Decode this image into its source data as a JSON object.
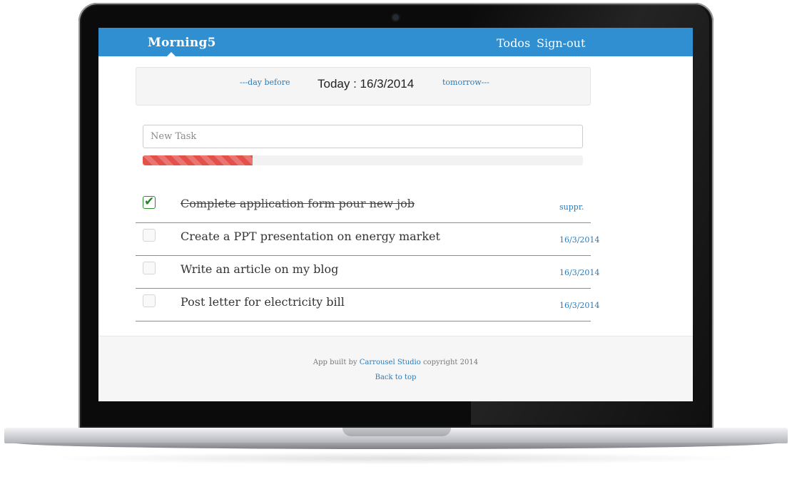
{
  "navbar": {
    "brand": "Morning5",
    "links": {
      "todos": "Todos",
      "signout": "Sign-out"
    },
    "color": "#2f8fd0"
  },
  "date_nav": {
    "prev_label": "---day before",
    "today_label": "Today : 16/3/2014",
    "next_label": "tomorrow---"
  },
  "new_task": {
    "placeholder": "New Task",
    "value": ""
  },
  "progress": {
    "percent": 25,
    "color": "#e4504a"
  },
  "tasks": [
    {
      "text": "Complete application form pour new job",
      "done": true,
      "meta": "suppr."
    },
    {
      "text": "Create a PPT presentation on energy market",
      "done": false,
      "meta": "16/3/2014"
    },
    {
      "text": "Write an article on my blog",
      "done": false,
      "meta": "16/3/2014"
    },
    {
      "text": "Post letter for electricity bill",
      "done": false,
      "meta": "16/3/2014"
    }
  ],
  "footer": {
    "prefix": "App built by ",
    "studio_link": "Carrousel Studio",
    "suffix": " copyright 2014",
    "back_to_top": "Back to top"
  },
  "icons": {
    "check": "check-icon"
  }
}
